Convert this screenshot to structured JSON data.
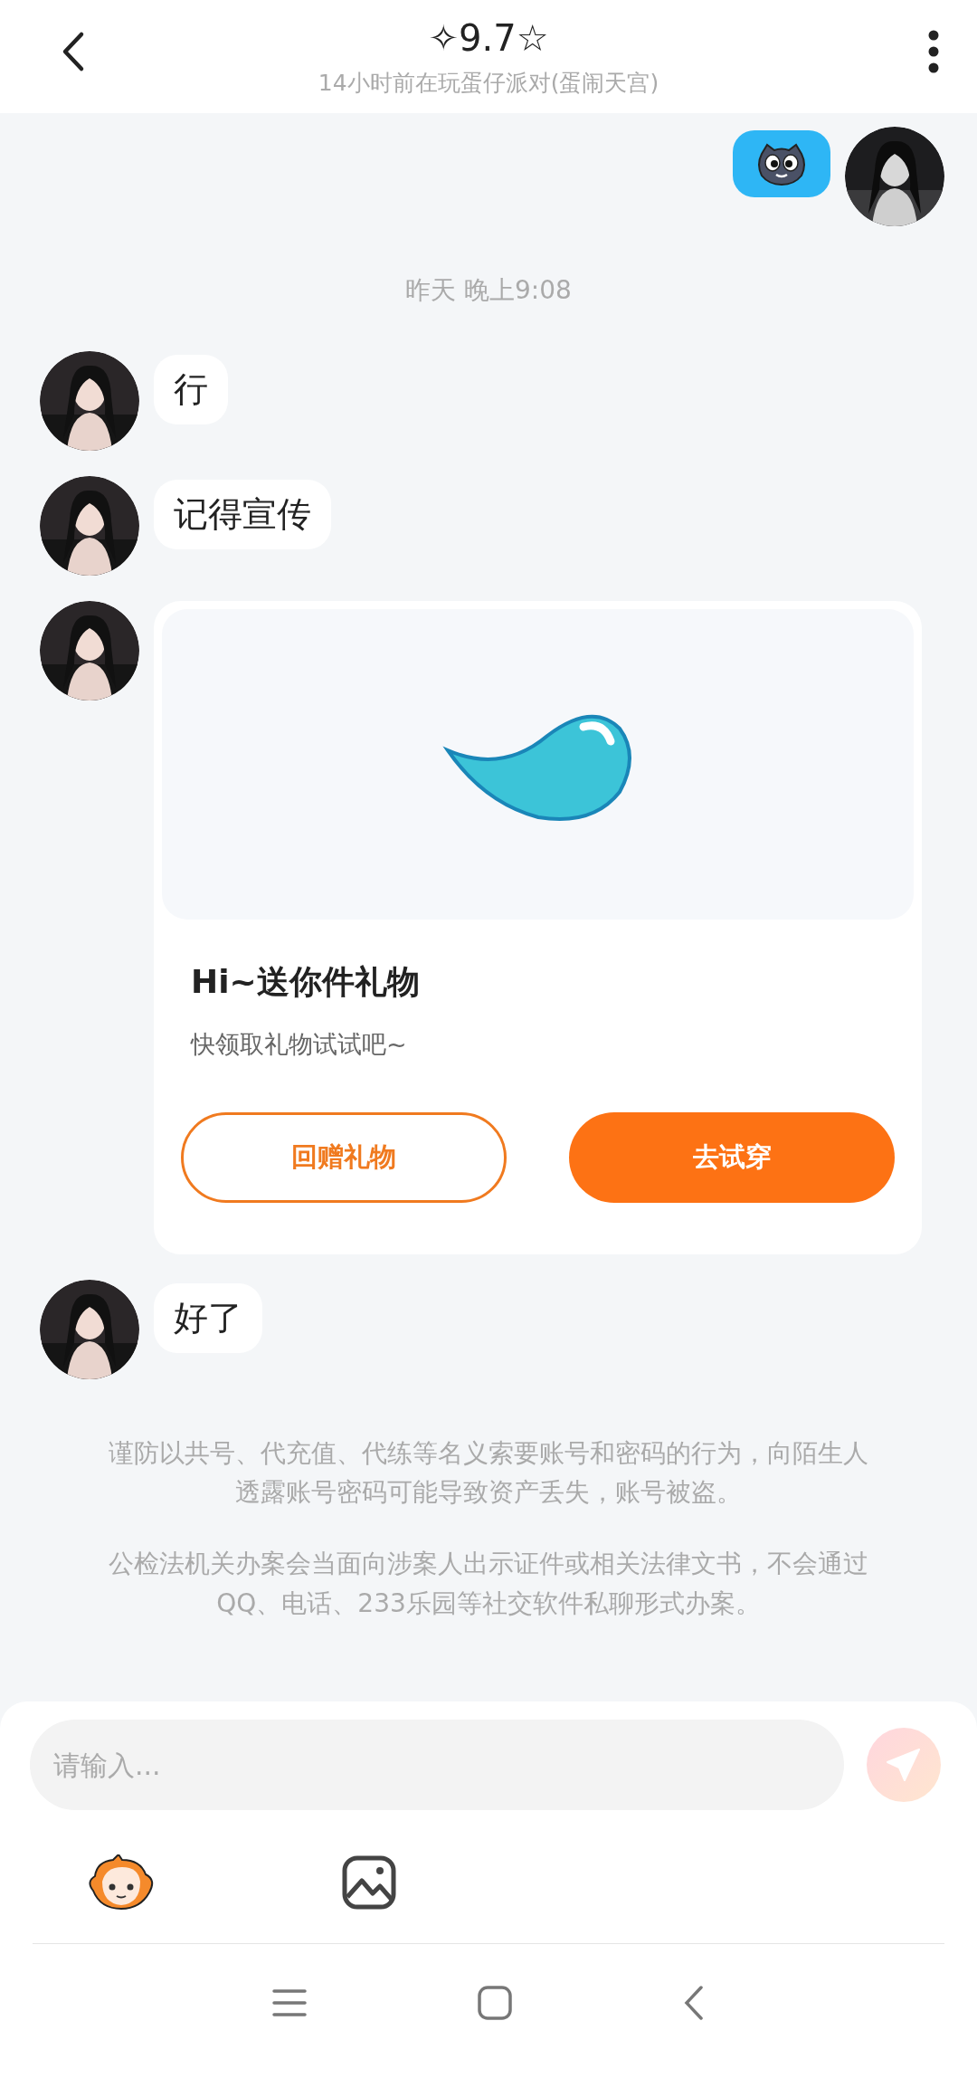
{
  "header": {
    "title": "✧9.7☆",
    "subtitle": "14小时前在玩蛋仔派对(蛋闹天宫)"
  },
  "messages": [
    {
      "kind": "sticker",
      "from_me": true
    },
    {
      "kind": "time",
      "text": "昨天 晚上9:08"
    },
    {
      "kind": "text",
      "from_me": false,
      "text": "行"
    },
    {
      "kind": "text",
      "from_me": false,
      "text": "记得宣传"
    },
    {
      "kind": "gift",
      "from_me": false,
      "title": "Hi~送你件礼物",
      "subtitle": "快领取礼物试试吧~",
      "buttons": [
        {
          "label": "回赠礼物",
          "kind": "outline"
        },
        {
          "label": "去试穿",
          "kind": "solid"
        }
      ]
    },
    {
      "kind": "text",
      "from_me": false,
      "text": "好了"
    }
  ],
  "notices": [
    "谨防以共号、代充值、代练等名义索要账号和密码的行为，向陌生人透露账号密码可能导致资产丢失，账号被盗。",
    "公检法机关办案会当面向涉案人出示证件或相关法律文书，不会通过QQ、电话、233乐园等社交软件私聊形式办案。"
  ],
  "composer": {
    "placeholder": "请输入...",
    "send_disabled": true
  }
}
